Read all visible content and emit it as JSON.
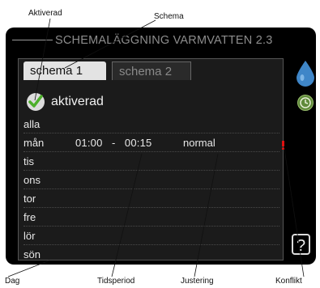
{
  "callouts": {
    "aktiverad": "Aktiverad",
    "schema": "Schema",
    "dag": "Dag",
    "tidsperiod": "Tidsperiod",
    "justering": "Justering",
    "konflikt": "Konflikt"
  },
  "screen": {
    "title": "SCHEMALÄGGNING VARMVATTEN 2.3",
    "tabs": [
      {
        "label": "schema 1",
        "active": true
      },
      {
        "label": "schema 2",
        "active": false
      }
    ],
    "activated_label": "aktiverad",
    "rows": [
      {
        "day": "alla",
        "period": "",
        "adjust": ""
      },
      {
        "day": "mån",
        "period": "01:00   -   00:15",
        "adjust": "normal"
      },
      {
        "day": "tis",
        "period": "",
        "adjust": ""
      },
      {
        "day": "ons",
        "period": "",
        "adjust": ""
      },
      {
        "day": "tor",
        "period": "",
        "adjust": ""
      },
      {
        "day": "fre",
        "period": "",
        "adjust": ""
      },
      {
        "day": "lör",
        "period": "",
        "adjust": ""
      },
      {
        "day": "sön",
        "period": "",
        "adjust": ""
      }
    ],
    "help_label": "?"
  },
  "icons": {
    "water_drop": "water-drop-icon",
    "clock": "clock-icon",
    "checkmark": "checkmark-icon",
    "conflict": "conflict-marker-icon",
    "help": "help-icon"
  },
  "colors": {
    "screen_bg": "#000000",
    "drop": "#3f86c8",
    "check": "#4caf2a",
    "conflict": "#e01010",
    "clock": "#5f8a3a"
  }
}
